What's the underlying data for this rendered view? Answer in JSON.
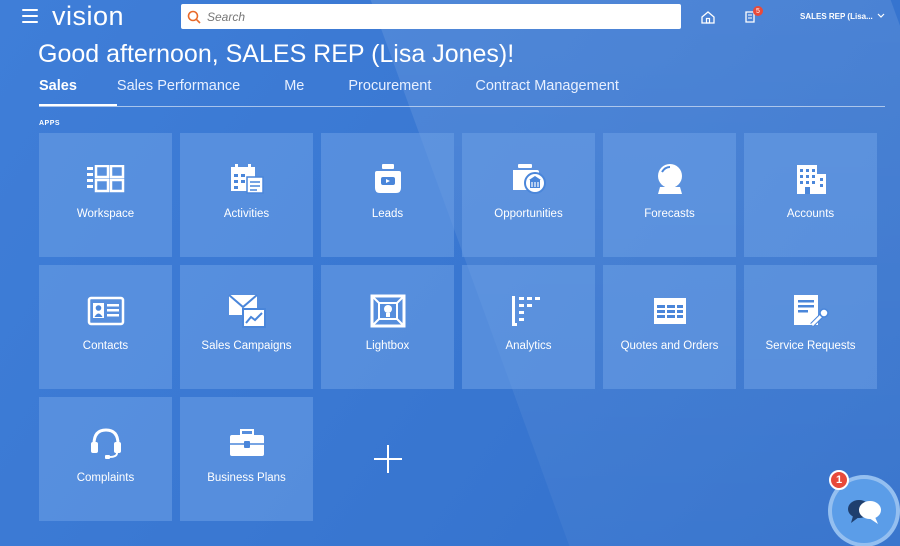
{
  "header": {
    "brand": "vision",
    "search_placeholder": "Search",
    "notification_count": "5",
    "user_label": "SALES REP (Lisa..."
  },
  "greeting": "Good afternoon, SALES REP (Lisa Jones)!",
  "tabs": [
    {
      "label": "Sales",
      "active": true
    },
    {
      "label": "Sales Performance"
    },
    {
      "label": "Me"
    },
    {
      "label": "Procurement"
    },
    {
      "label": "Contract Management"
    }
  ],
  "apps_label": "APPS",
  "apps": [
    {
      "label": "Workspace",
      "icon": "workspace-icon"
    },
    {
      "label": "Activities",
      "icon": "calendar-icon"
    },
    {
      "label": "Leads",
      "icon": "leads-icon"
    },
    {
      "label": "Opportunities",
      "icon": "opportunities-icon"
    },
    {
      "label": "Forecasts",
      "icon": "crystal-ball-icon"
    },
    {
      "label": "Accounts",
      "icon": "building-icon"
    },
    {
      "label": "Contacts",
      "icon": "contact-card-icon"
    },
    {
      "label": "Sales Campaigns",
      "icon": "campaign-envelope-icon"
    },
    {
      "label": "Lightbox",
      "icon": "lightbox-icon"
    },
    {
      "label": "Analytics",
      "icon": "analytics-icon"
    },
    {
      "label": "Quotes and Orders",
      "icon": "spreadsheet-icon"
    },
    {
      "label": "Service Requests",
      "icon": "service-wrench-icon"
    },
    {
      "label": "Complaints",
      "icon": "headset-icon"
    },
    {
      "label": "Business Plans",
      "icon": "briefcase-icon"
    }
  ],
  "add_tile_icon": "plus-icon",
  "chat": {
    "badge_count": "1",
    "icon": "chat-bubbles-icon"
  },
  "colors": {
    "background": "#3a78d2",
    "tile": "#6ea0e6",
    "badge": "#e84a3a"
  }
}
